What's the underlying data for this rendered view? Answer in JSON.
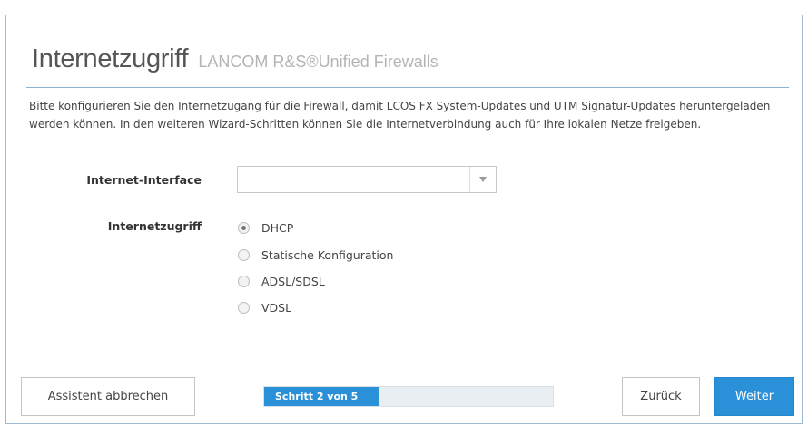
{
  "header": {
    "title": "Internetzugriff",
    "subtitle": "LANCOM R&S®Unified Firewalls"
  },
  "description": "Bitte konfigurieren Sie den Internetzugang für die Firewall, damit LCOS FX System-Updates und UTM Signatur-Updates heruntergeladen werden können. In den weiteren Wizard-Schritten können Sie die Internetverbindung auch für Ihre lokalen Netze freigeben.",
  "interface": {
    "label": "Internet-Interface",
    "selected_value": ""
  },
  "access": {
    "label": "Internetzugriff",
    "options": [
      {
        "label": "DHCP",
        "checked": true
      },
      {
        "label": "Statische Konfiguration",
        "checked": false
      },
      {
        "label": "ADSL/SDSL",
        "checked": false
      },
      {
        "label": "VDSL",
        "checked": false
      }
    ]
  },
  "footer": {
    "cancel_label": "Assistent abbrechen",
    "back_label": "Zurück",
    "next_label": "Weiter",
    "progress_text": "Schritt 2 von 5",
    "progress_current": 2,
    "progress_total": 5
  },
  "colors": {
    "accent": "#2a90d8",
    "border": "#9fbad1"
  },
  "icons": {
    "select_arrow": "chevron-down-icon"
  }
}
